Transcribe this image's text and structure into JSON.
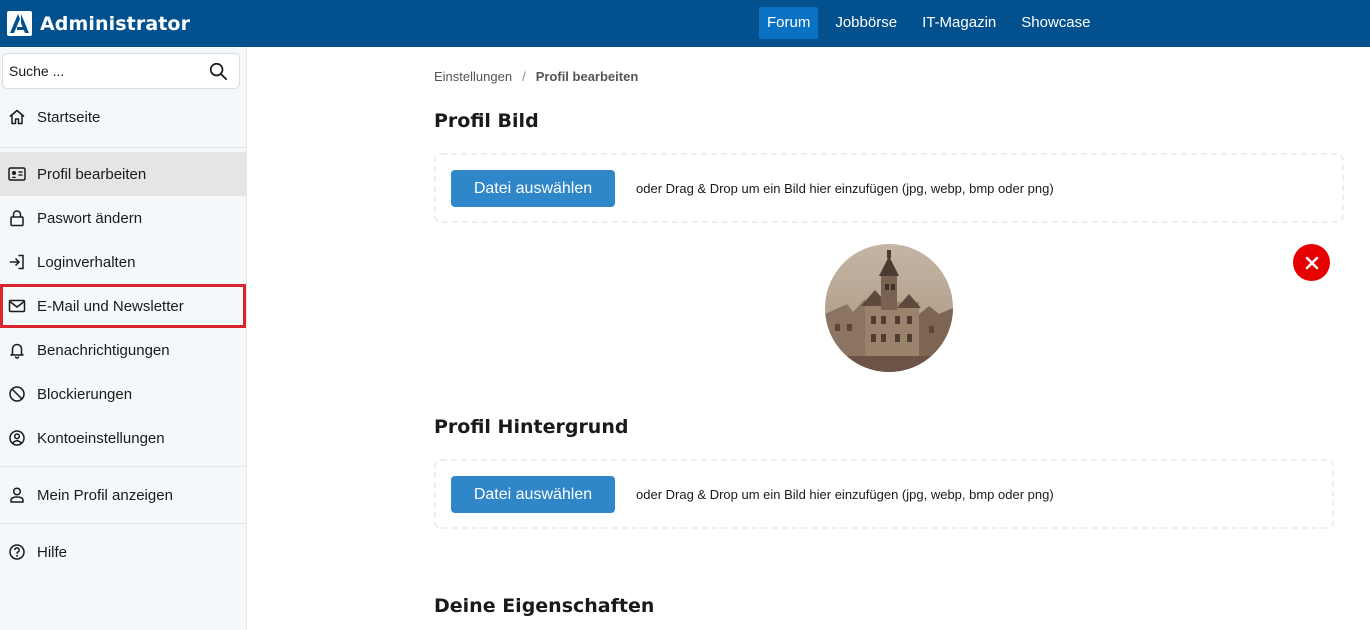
{
  "brand": {
    "name": "Administrator",
    "logo_icon": "brand-logo-icon"
  },
  "topnav": [
    {
      "label": "Forum",
      "active": true
    },
    {
      "label": "Jobbörse",
      "active": false
    },
    {
      "label": "IT-Magazin",
      "active": false
    },
    {
      "label": "Showcase",
      "active": false
    }
  ],
  "search": {
    "placeholder": "Suche ...",
    "icon": "search-icon"
  },
  "sidebar": {
    "items": [
      {
        "label": "Startseite",
        "icon": "home-icon"
      },
      {
        "label": "Profil bearbeiten",
        "icon": "id-card-icon",
        "active": true
      },
      {
        "label": "Paswort ändern",
        "icon": "lock-icon"
      },
      {
        "label": "Loginverhalten",
        "icon": "login-icon"
      },
      {
        "label": "E-Mail und Newsletter",
        "icon": "envelope-icon",
        "highlighted": true
      },
      {
        "label": "Benachrichtigungen",
        "icon": "bell-icon"
      },
      {
        "label": "Blockierungen",
        "icon": "block-icon"
      },
      {
        "label": "Kontoeinstellungen",
        "icon": "user-circle-icon"
      },
      {
        "label": "Mein Profil anzeigen",
        "icon": "user-icon"
      },
      {
        "label": "Hilfe",
        "icon": "help-icon"
      }
    ]
  },
  "breadcrumb": {
    "parent": "Einstellungen",
    "separator": "/",
    "current": "Profil bearbeiten"
  },
  "profile_image": {
    "title": "Profil Bild",
    "button_label": "Datei auswählen",
    "hint": "oder Drag & Drop um ein Bild hier einzufügen (jpg, webp, bmp oder png)"
  },
  "profile_background": {
    "title": "Profil Hintergrund",
    "button_label": "Datei auswählen",
    "hint": "oder Drag & Drop um ein Bild hier einzufügen (jpg, webp, bmp oder png)"
  },
  "properties": {
    "title": "Deine Eigenschaften"
  },
  "colors": {
    "header": "#02518e",
    "active_tab": "#0a72c2",
    "button": "#2f86c8",
    "remove": "#e60000",
    "highlight_border": "#d9252b"
  }
}
